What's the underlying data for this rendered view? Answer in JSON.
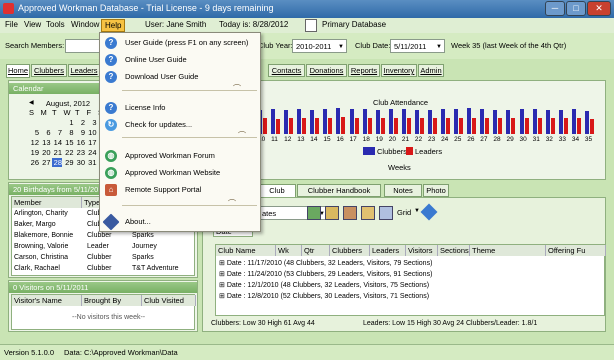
{
  "window": {
    "title": "Approved Workman Database - Trial License - 9 days remaining",
    "minimize": "─",
    "maximize": "□",
    "close": "✕"
  },
  "menubar": {
    "items": [
      "File",
      "View",
      "Tools",
      "Window",
      "Help"
    ],
    "user": "User: Jane Smith",
    "today": "Today is: 8/28/2012",
    "primary_db": "Primary Database"
  },
  "toolbar": {
    "search_label": "Search Members:",
    "club_year_label": "Club Year:",
    "club_year_value": "2010-2011",
    "club_date_label": "Club Date:",
    "club_date_value": "5/11/2011",
    "week_info": "Week 35 (last Week of the 4th Qtr)"
  },
  "tabs": [
    "Home",
    "Clubbers",
    "Leaders",
    "Contacts",
    "Donations",
    "Reports",
    "Inventory",
    "Admin"
  ],
  "calendar": {
    "header": "Calendar",
    "month": "August, 2012",
    "day_names": [
      "S",
      "M",
      "T",
      "W",
      "T",
      "F",
      "S"
    ],
    "rows": [
      [
        "",
        "",
        "",
        "1",
        "2",
        "3",
        "4"
      ],
      [
        "5",
        "6",
        "7",
        "8",
        "9",
        "10",
        "11"
      ],
      [
        "12",
        "13",
        "14",
        "15",
        "16",
        "17",
        "18"
      ],
      [
        "19",
        "20",
        "21",
        "22",
        "23",
        "24",
        "25"
      ],
      [
        "26",
        "27",
        "28",
        "29",
        "30",
        "31",
        ""
      ]
    ],
    "today": "28"
  },
  "birthdays": {
    "header": "20 Birthdays from 5/11/2011",
    "columns": [
      "Member",
      "Type"
    ],
    "rows": [
      [
        "Arlington, Charity",
        "Clubber",
        ""
      ],
      [
        "Baker, Margo",
        "Clubber",
        ""
      ],
      [
        "Blakemore, Bonnie",
        "Clubber",
        "Sparks"
      ],
      [
        "Browning, Valorie",
        "Leader",
        "Journey"
      ],
      [
        "Carson, Christina",
        "Clubber",
        "Sparks"
      ],
      [
        "Clark, Rachael",
        "Clubber",
        "T&T Adventure"
      ]
    ]
  },
  "visitors": {
    "header": "0 Visitors on 5/11/2011",
    "columns": [
      "Visitor's Name",
      "Brought By",
      "Club Visited"
    ],
    "empty": "--No visitors this week--"
  },
  "attendance": {
    "title": "Club Attendance",
    "legend": [
      "Clubbers",
      "Leaders"
    ],
    "xlabel": "Weeks",
    "weeks": [
      "10",
      "11",
      "12",
      "13",
      "14",
      "15",
      "16",
      "17",
      "18",
      "19",
      "20",
      "21",
      "22",
      "23",
      "24",
      "25",
      "26",
      "27",
      "28",
      "29",
      "30",
      "31",
      "32",
      "33",
      "34",
      "35"
    ],
    "clubbers": [
      60,
      62,
      60,
      63,
      61,
      62,
      64,
      63,
      62,
      61,
      63,
      62,
      60,
      61,
      62,
      63,
      64,
      62,
      61,
      60,
      62,
      63,
      61,
      60,
      62,
      58
    ],
    "leaders": [
      40,
      38,
      41,
      40,
      39,
      40,
      42,
      41,
      40,
      39,
      40,
      41,
      40,
      39,
      40,
      41,
      40,
      39,
      41,
      40,
      39,
      40,
      41,
      40,
      39,
      37
    ],
    "colors": {
      "clubbers": "#2a2ab0",
      "leaders": "#d81818"
    }
  },
  "subtabs": [
    "Club Calendar",
    "Clubber Handbook Alerts",
    "Notes",
    "Photo"
  ],
  "templates_label": "ates",
  "grid_label": "Grid",
  "date_group_header": "Date",
  "club_grid": {
    "columns": [
      "Club Name",
      "Wk",
      "Qtr",
      "Clubbers",
      "Leaders",
      "Visitors",
      "Sections",
      "Theme",
      "Offering Fu"
    ],
    "rows": [
      "Date : 11/17/2010 (48 Clubbers, 32 Leaders,  Visitors, 79 Sections)",
      "Date : 11/24/2010 (53 Clubbers, 29 Leaders,  Visitors, 91 Sections)",
      "Date : 12/1/2010 (48 Clubbers, 32 Leaders,  Visitors, 75 Sections)",
      "Date : 12/8/2010 (52 Clubbers, 30 Leaders,  Visitors, 71 Sections)"
    ],
    "footer_clubbers": "Clubbers: Low 30   High 61   Avg 44",
    "footer_leaders": "Leaders: Low 15   High 30   Avg 24   Clubbers/Leader: 1.8/1"
  },
  "help_menu": [
    {
      "label": "User Guide   (press F1 on any screen)",
      "icon": "help-icon"
    },
    {
      "label": "Online User Guide",
      "icon": "help-icon"
    },
    {
      "label": "Download User Guide",
      "icon": "help-icon"
    },
    {
      "label": "License Info",
      "icon": "help-icon"
    },
    {
      "label": "Check for updates...",
      "icon": "update-icon"
    },
    {
      "label": "Approved Workman Forum",
      "icon": "globe-icon"
    },
    {
      "label": "Approved Workman Website",
      "icon": "globe-icon"
    },
    {
      "label": "Remote Support Portal",
      "icon": "home-icon"
    },
    {
      "label": "About...",
      "icon": "info-icon"
    }
  ],
  "status": {
    "version": "Version 5.1.0.0",
    "data_path": "Data: C:\\Approved Workman\\Data"
  }
}
